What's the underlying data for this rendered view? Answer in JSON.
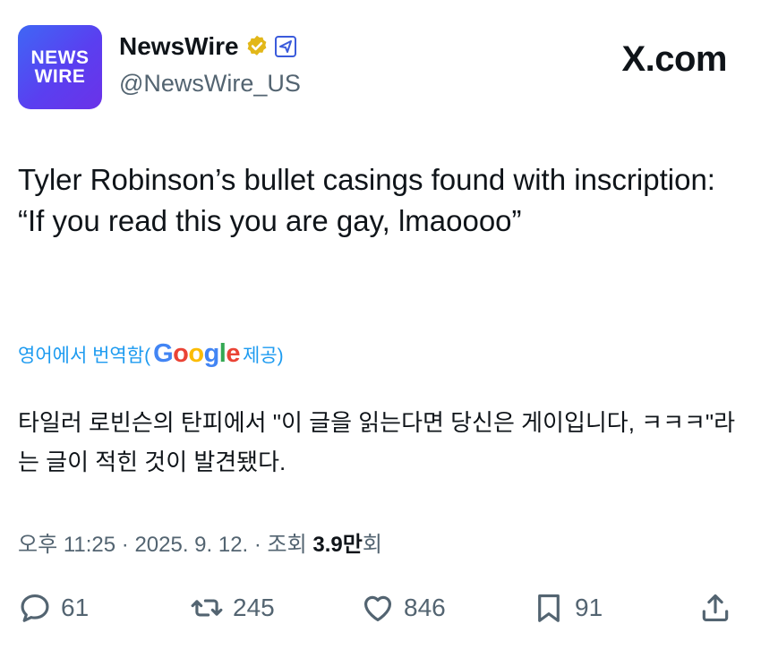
{
  "account": {
    "avatar_line1": "NEWS",
    "avatar_line2": "WIRE",
    "display_name": "NewsWire",
    "handle": "@NewsWire_US",
    "verified_icon": "verified-badge-gold",
    "affiliation_icon": "affiliate-badge"
  },
  "watermark": "X.com",
  "tweet": {
    "text": "Tyler Robinson’s bullet casings found with inscription: “If you read this you are gay, lmaoooo”",
    "translated_label_prefix": "영어에서 번역함(",
    "translated_label_google": "Google",
    "translated_label_suffix": " 제공)",
    "translated_text": "타일러 로빈슨의 탄피에서 \"이 글을 읽는다면 당신은 게이입니다, ㅋㅋㅋ\"라는 글이 적힌 것이 발견됐다.",
    "time": "오후 11:25",
    "date": "2025. 9. 12.",
    "views_label": "조회",
    "views_value": "3.9만",
    "views_suffix": "회"
  },
  "actions": {
    "replies": "61",
    "reposts": "245",
    "likes": "846",
    "bookmarks": "91"
  },
  "colors": {
    "accent": "#1d9bf0",
    "secondary_text": "#536471",
    "primary_text": "#0f1419",
    "avatar_gradient_start": "#3f67f5",
    "avatar_gradient_end": "#6b32e8"
  }
}
